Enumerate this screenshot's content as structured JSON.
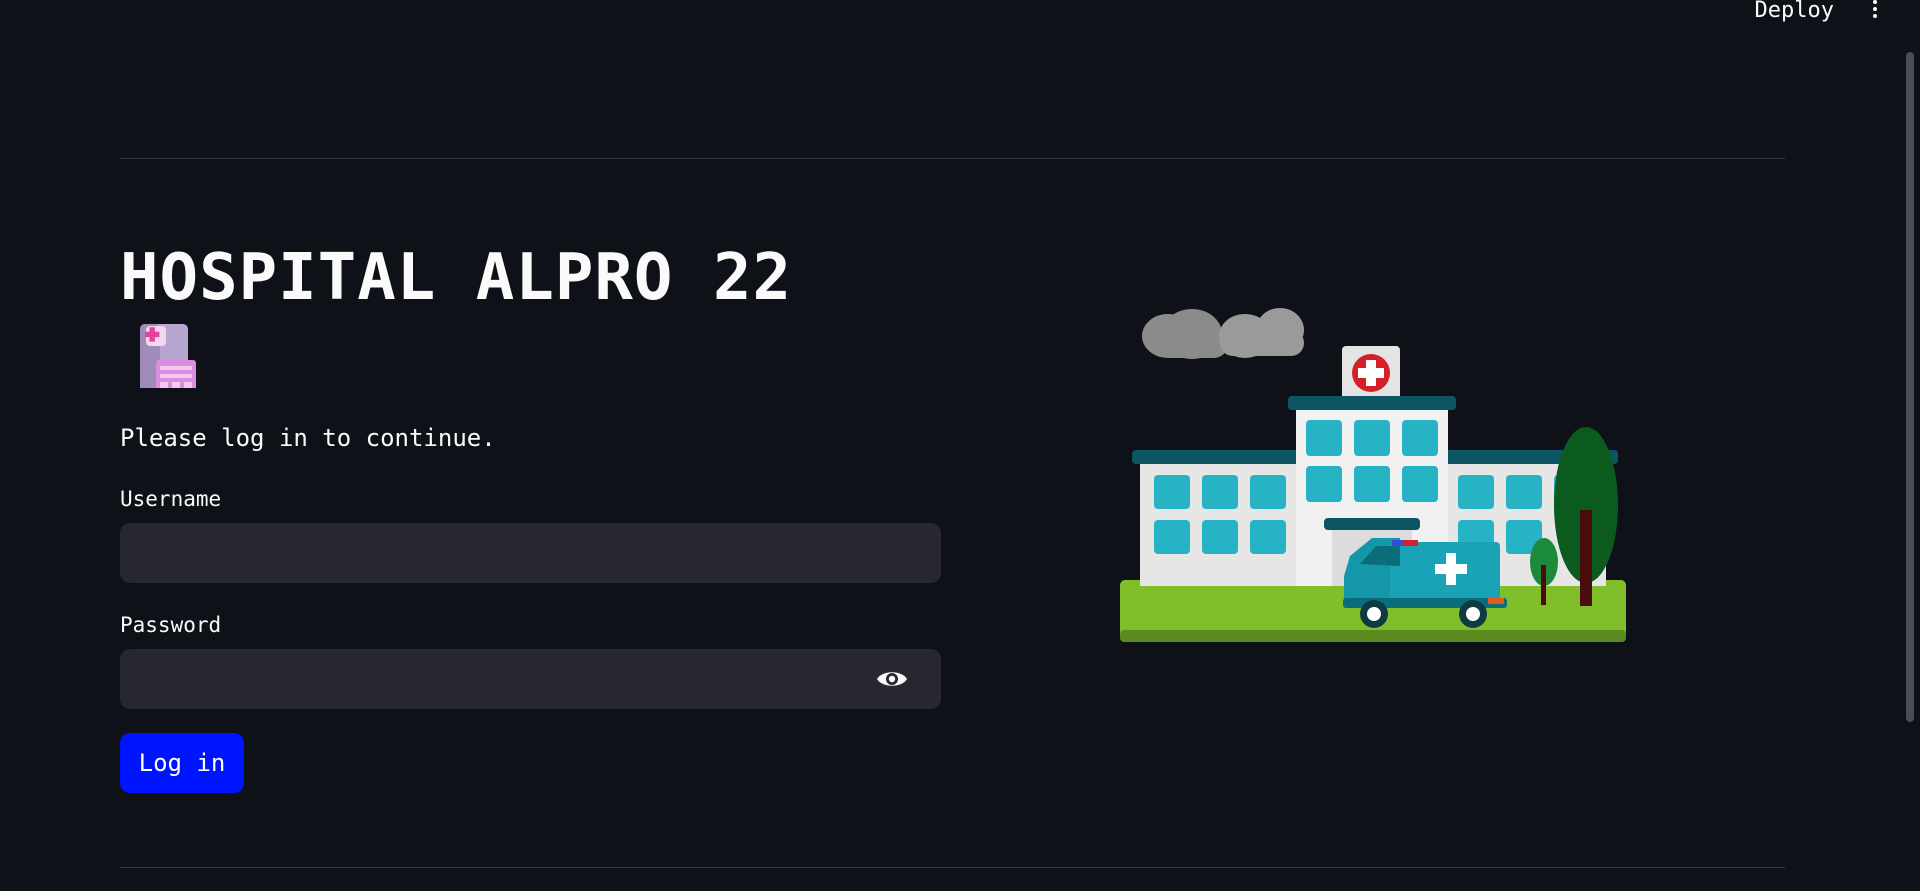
{
  "header": {
    "deploy_label": "Deploy",
    "menu_icon": "kebab-menu-icon"
  },
  "page": {
    "title": "HOSPITAL ALPRO 22",
    "title_icon": "hospital-emoji-icon",
    "subtitle": "Please log in to continue."
  },
  "form": {
    "username_label": "Username",
    "username_value": "",
    "password_label": "Password",
    "password_value": "",
    "password_toggle_icon": "eye-icon",
    "submit_label": "Log in"
  },
  "illustration": {
    "icon": "hospital-illustration"
  },
  "colors": {
    "background": "#0e1117",
    "input_bg": "#262730",
    "primary_button": "#0015ff",
    "text": "#fafafa"
  }
}
